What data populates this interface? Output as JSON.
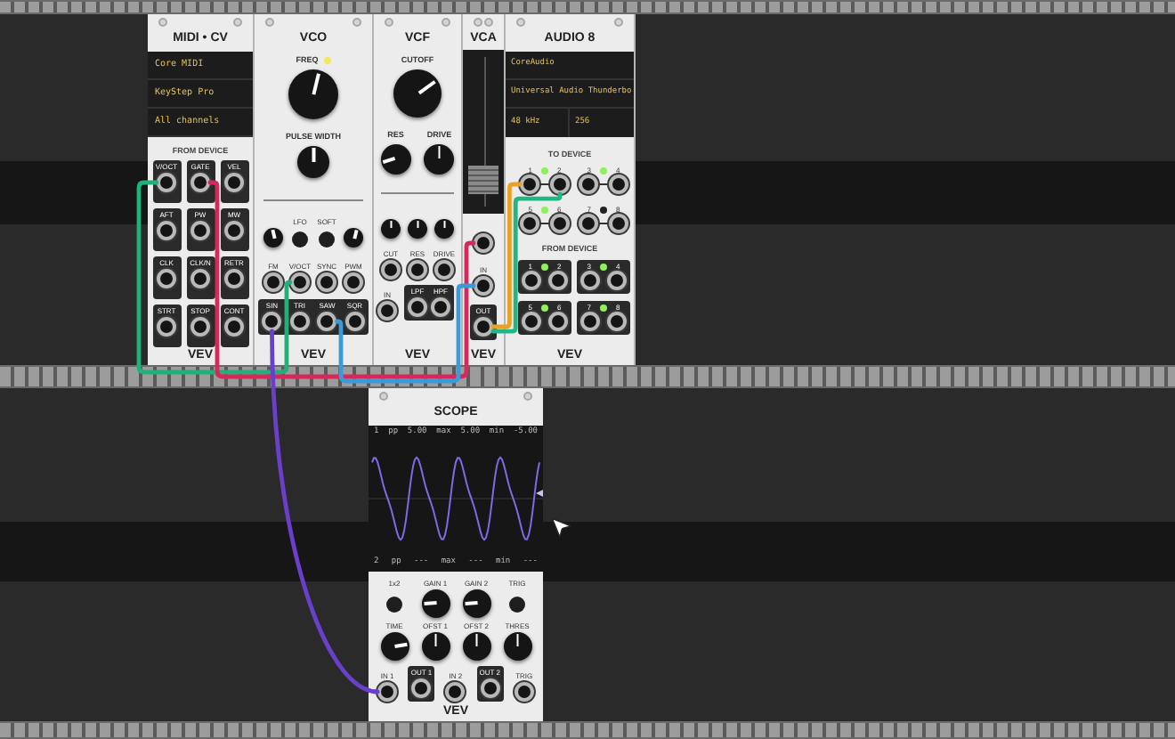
{
  "modules": [
    {
      "kind": "midi",
      "title": "MIDI • CV",
      "display": [
        "Core MIDI",
        "KeyStep Pro",
        "All channels"
      ],
      "section": "FROM DEVICE",
      "ports": [
        "V/OCT",
        "GATE",
        "VEL",
        "AFT",
        "PW",
        "MW",
        "CLK",
        "CLK/N",
        "RETR",
        "STRT",
        "STOP",
        "CONT"
      ],
      "brand": "VEV"
    },
    {
      "kind": "vco",
      "title": "VCO",
      "freq": {
        "label": "FREQ",
        "level": 0.55,
        "light": true
      },
      "pw": {
        "label": "PULSE WIDTH",
        "level": 0.5
      },
      "trims": [
        {
          "level": 0.45
        },
        {
          "level": 0.55
        }
      ],
      "switches": [
        "LFO",
        "SOFT"
      ],
      "inputs": [
        "FM",
        "V/OCT",
        "SYNC",
        "PWM"
      ],
      "outputs": [
        "SIN",
        "TRI",
        "SAW",
        "SQR"
      ],
      "brand": "VEV"
    },
    {
      "kind": "vcf",
      "title": "VCF",
      "cutoff": {
        "label": "CUTOFF",
        "level": 0.7
      },
      "knobs": [
        {
          "label": "RES",
          "level": 0.1
        },
        {
          "label": "DRIVE",
          "level": 0.5
        }
      ],
      "trims": [
        {
          "level": 0.5
        },
        {
          "level": 0.5
        },
        {
          "level": 0.5
        }
      ],
      "inputs": [
        "CUT",
        "RES",
        "DRIVE"
      ],
      "input": "IN",
      "outputs": [
        "LPF",
        "HPF"
      ],
      "brand": "VEV"
    },
    {
      "kind": "vca",
      "title": "VCA",
      "level": 0.15,
      "input": "IN",
      "output": "OUT",
      "brand": "VEV"
    },
    {
      "kind": "audio",
      "title": "AUDIO 8",
      "display": [
        "CoreAudio",
        "Universal Audio Thunderbo"
      ],
      "rate": "48 kHz",
      "block": "256",
      "to_section": "TO DEVICE",
      "to_pairs": [
        {
          "ports": [
            "1",
            "2"
          ],
          "lit": true
        },
        {
          "ports": [
            "3",
            "4"
          ],
          "lit": true
        },
        {
          "ports": [
            "5",
            "6"
          ],
          "lit": true
        },
        {
          "ports": [
            "7",
            "8"
          ],
          "lit": false
        }
      ],
      "from_section": "FROM DEVICE",
      "from_pairs": [
        {
          "ports": [
            "1",
            "2"
          ],
          "lit": true
        },
        {
          "ports": [
            "3",
            "4"
          ],
          "lit": true
        },
        {
          "ports": [
            "5",
            "6"
          ],
          "lit": true
        },
        {
          "ports": [
            "7",
            "8"
          ],
          "lit": true
        }
      ],
      "brand": "VEV"
    }
  ],
  "scope": {
    "title": "SCOPE",
    "top_stats": [
      "1",
      "pp",
      "5.00",
      "max",
      "5.00",
      "min",
      "-5.00"
    ],
    "bottom_stats": [
      "2",
      "pp",
      "---",
      "max",
      "---",
      "min",
      "---"
    ],
    "buttons": [
      "1x2",
      "TRIG"
    ],
    "knobs": [
      {
        "label": "GAIN 1",
        "level": 0.15
      },
      {
        "label": "GAIN 2",
        "level": 0.15
      },
      {
        "label": "TIME",
        "level": 0.8
      },
      {
        "label": "OFST 1",
        "level": 0.5
      },
      {
        "label": "OFST 2",
        "level": 0.5
      },
      {
        "label": "THRES",
        "level": 0.5
      }
    ],
    "ports": [
      {
        "label": "IN 1",
        "kind": "input"
      },
      {
        "label": "OUT 1",
        "kind": "output"
      },
      {
        "label": "IN 2",
        "kind": "input"
      },
      {
        "label": "OUT 2",
        "kind": "output"
      },
      {
        "label": "TRIG",
        "kind": "input"
      }
    ],
    "brand": "VEV"
  },
  "cables": [
    {
      "color": "#22b07a"
    },
    {
      "color": "#d6285b"
    },
    {
      "color": "#3a9bd8"
    },
    {
      "color": "#6a3fc9"
    },
    {
      "color": "#e8a22a"
    },
    {
      "color": "#1fb883"
    }
  ]
}
